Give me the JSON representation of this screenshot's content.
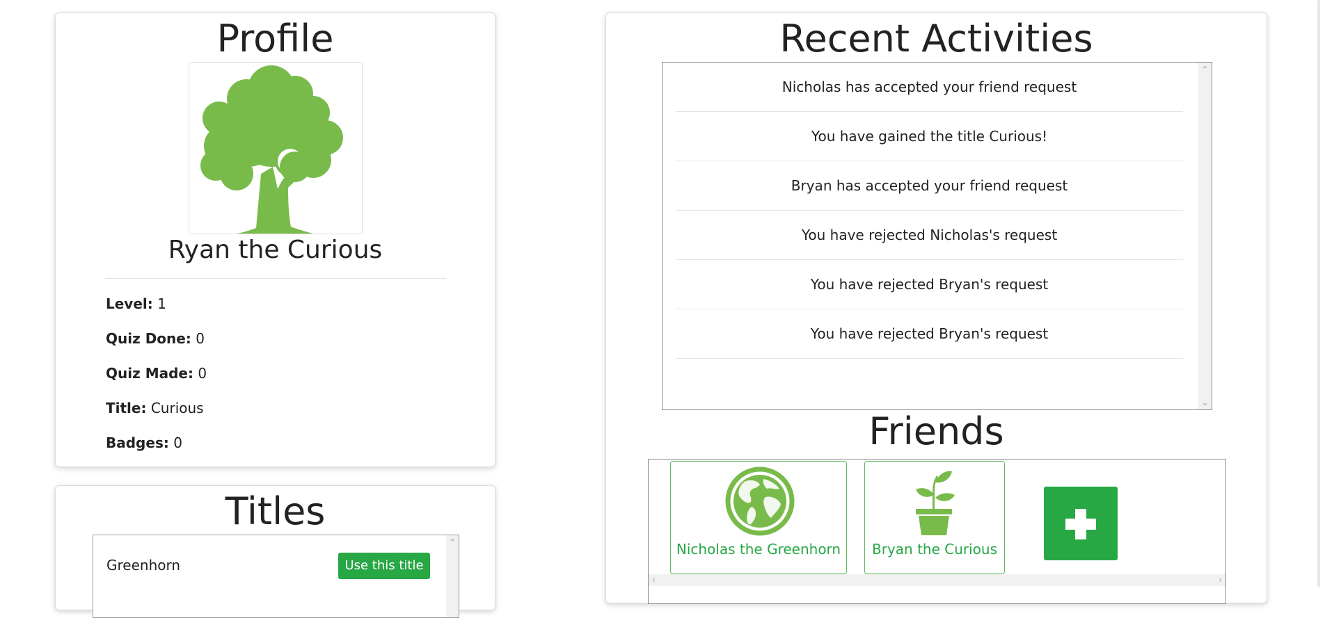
{
  "profile": {
    "heading": "Profile",
    "avatar_icon": "tree-icon",
    "name": "Ryan the Curious",
    "stats": {
      "level": {
        "label": "Level:",
        "value": "1"
      },
      "quiz_done": {
        "label": "Quiz Done:",
        "value": "0"
      },
      "quiz_made": {
        "label": "Quiz Made:",
        "value": "0"
      },
      "title": {
        "label": "Title:",
        "value": "Curious"
      },
      "badges": {
        "label": "Badges:",
        "value": "0"
      }
    }
  },
  "titles": {
    "heading": "Titles",
    "items": [
      {
        "name": "Greenhorn",
        "button": "Use this title"
      }
    ]
  },
  "activities": {
    "heading": "Recent Activities",
    "items": [
      "Nicholas has accepted your friend request",
      "You have gained the title Curious!",
      "Bryan has accepted your friend request",
      "You have rejected Nicholas's request",
      "You have rejected Bryan's request",
      "You have rejected Bryan's request"
    ]
  },
  "friends": {
    "heading": "Friends",
    "items": [
      {
        "name": "Nicholas the Greenhorn",
        "icon": "globe-icon"
      },
      {
        "name": "Bryan the Curious",
        "icon": "potted-plant-icon"
      }
    ],
    "add_icon": "plus-icon"
  },
  "colors": {
    "accent_green": "#28a745",
    "icon_green": "#79bb4b"
  }
}
